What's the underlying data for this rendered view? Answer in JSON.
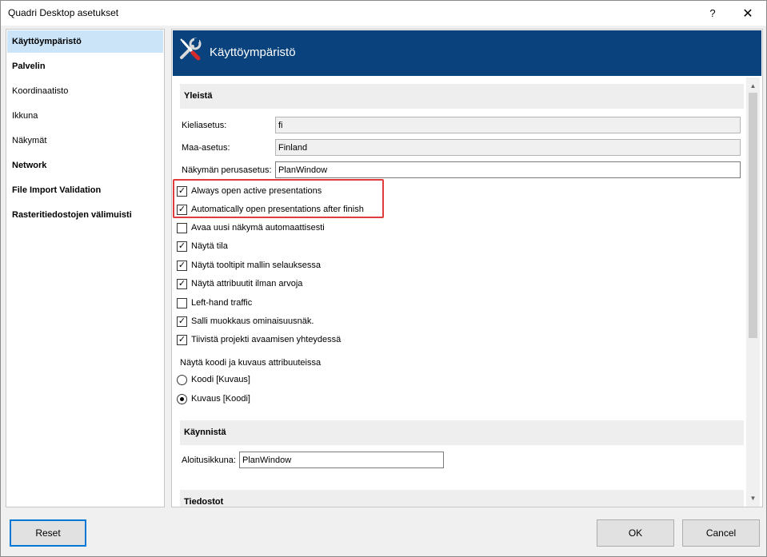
{
  "window": {
    "title": "Quadri Desktop asetukset",
    "help_label": "?",
    "close_label": "✕"
  },
  "nav": {
    "items": [
      {
        "label": "Käyttöympäristö",
        "bold": true,
        "selected": true
      },
      {
        "label": "Palvelin",
        "bold": true,
        "selected": false
      },
      {
        "label": "Koordinaatisto",
        "bold": false,
        "selected": false
      },
      {
        "label": "Ikkuna",
        "bold": false,
        "selected": false
      },
      {
        "label": "Näkymät",
        "bold": false,
        "selected": false
      },
      {
        "label": "Network",
        "bold": true,
        "selected": false
      },
      {
        "label": "File Import Validation",
        "bold": true,
        "selected": false
      },
      {
        "label": "Rasteritiedostojen välimuisti",
        "bold": true,
        "selected": false
      }
    ]
  },
  "banner": {
    "title": "Käyttöympäristö",
    "icon": "tools-icon",
    "color": "#0a427d"
  },
  "general": {
    "header": "Yleistä",
    "language_label": "Kieliasetus:",
    "language_value": "fi",
    "country_label": "Maa-asetus:",
    "country_value": "Finland",
    "view_label": "Näkymän perusasetus:",
    "view_value": "PlanWindow",
    "checkboxes": [
      {
        "label": "Always open active presentations",
        "checked": true
      },
      {
        "label": "Automatically open presentations after finish",
        "checked": true
      },
      {
        "label": "Avaa uusi näkymä automaattisesti",
        "checked": false
      },
      {
        "label": "Näytä tila",
        "checked": true
      },
      {
        "label": "Näytä tooltipit mallin selauksessa",
        "checked": true
      },
      {
        "label": "Näytä attribuutit ilman arvoja",
        "checked": true
      },
      {
        "label": "Left-hand traffic",
        "checked": false
      },
      {
        "label": "Salli muokkaus ominaisuusnäk.",
        "checked": true
      },
      {
        "label": "Tiivistä projekti avaamisen yhteydessä",
        "checked": true
      }
    ],
    "code_group_label": "Näytä koodi ja kuvaus attribuuteissa",
    "radios": [
      {
        "label": "Koodi [Kuvaus]",
        "selected": false
      },
      {
        "label": "Kuvaus [Koodi]",
        "selected": true
      }
    ]
  },
  "startup": {
    "header": "Käynnistä",
    "window_label": "Aloitusikkuna:",
    "window_value": "PlanWindow"
  },
  "files": {
    "header": "Tiedostot"
  },
  "buttons": {
    "reset": "Reset",
    "ok": "OK",
    "cancel": "Cancel"
  },
  "colors": {
    "highlight": "#e03c3c",
    "selection": "#cce4f7",
    "focus": "#0078d7"
  }
}
